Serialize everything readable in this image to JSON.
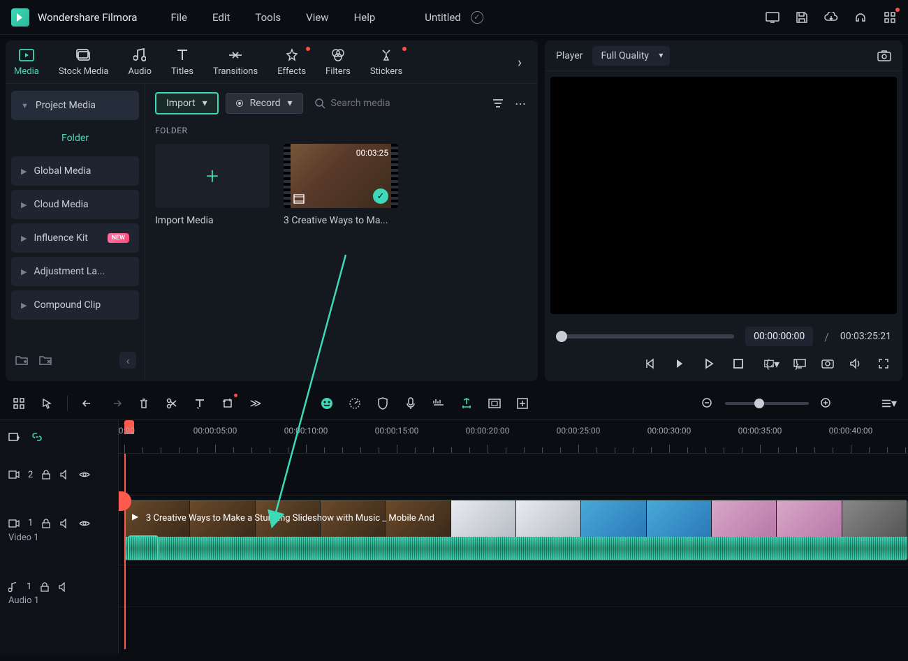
{
  "app": {
    "title": "Wondershare Filmora"
  },
  "menu": {
    "file": "File",
    "edit": "Edit",
    "tools": "Tools",
    "view": "View",
    "help": "Help"
  },
  "doc": {
    "title": "Untitled"
  },
  "tabs": {
    "media": "Media",
    "stock_media": "Stock Media",
    "audio": "Audio",
    "titles": "Titles",
    "transitions": "Transitions",
    "effects": "Effects",
    "filters": "Filters",
    "stickers": "Stickers"
  },
  "sidebar": {
    "project_media": "Project Media",
    "folder": "Folder",
    "global_media": "Global Media",
    "cloud_media": "Cloud Media",
    "influence_kit": "Influence Kit",
    "influence_badge": "NEW",
    "adjustment_layer": "Adjustment La...",
    "compound_clip": "Compound Clip"
  },
  "toolbar": {
    "import": "Import",
    "record": "Record",
    "search_placeholder": "Search media"
  },
  "folder": {
    "label": "FOLDER",
    "import_card": "Import Media",
    "clip": {
      "duration": "00:03:25",
      "name": "3 Creative Ways to Ma..."
    }
  },
  "player": {
    "label": "Player",
    "quality": "Full Quality",
    "current_time": "00:00:00:00",
    "total_time": "00:03:25:21"
  },
  "timeline": {
    "ticks": [
      "00:00",
      "00:00:05:00",
      "00:00:10:00",
      "00:00:15:00",
      "00:00:20:00",
      "00:00:25:00",
      "00:00:30:00",
      "00:00:35:00",
      "00:00:40:00"
    ],
    "track_v2": "2",
    "track_v1": "1",
    "track_v1_name": "Video 1",
    "track_a1": "1",
    "track_a1_name": "Audio 1",
    "clip_title": "3 Creative Ways to Make a Stunning Slideshow with Music _ Mobile And"
  }
}
